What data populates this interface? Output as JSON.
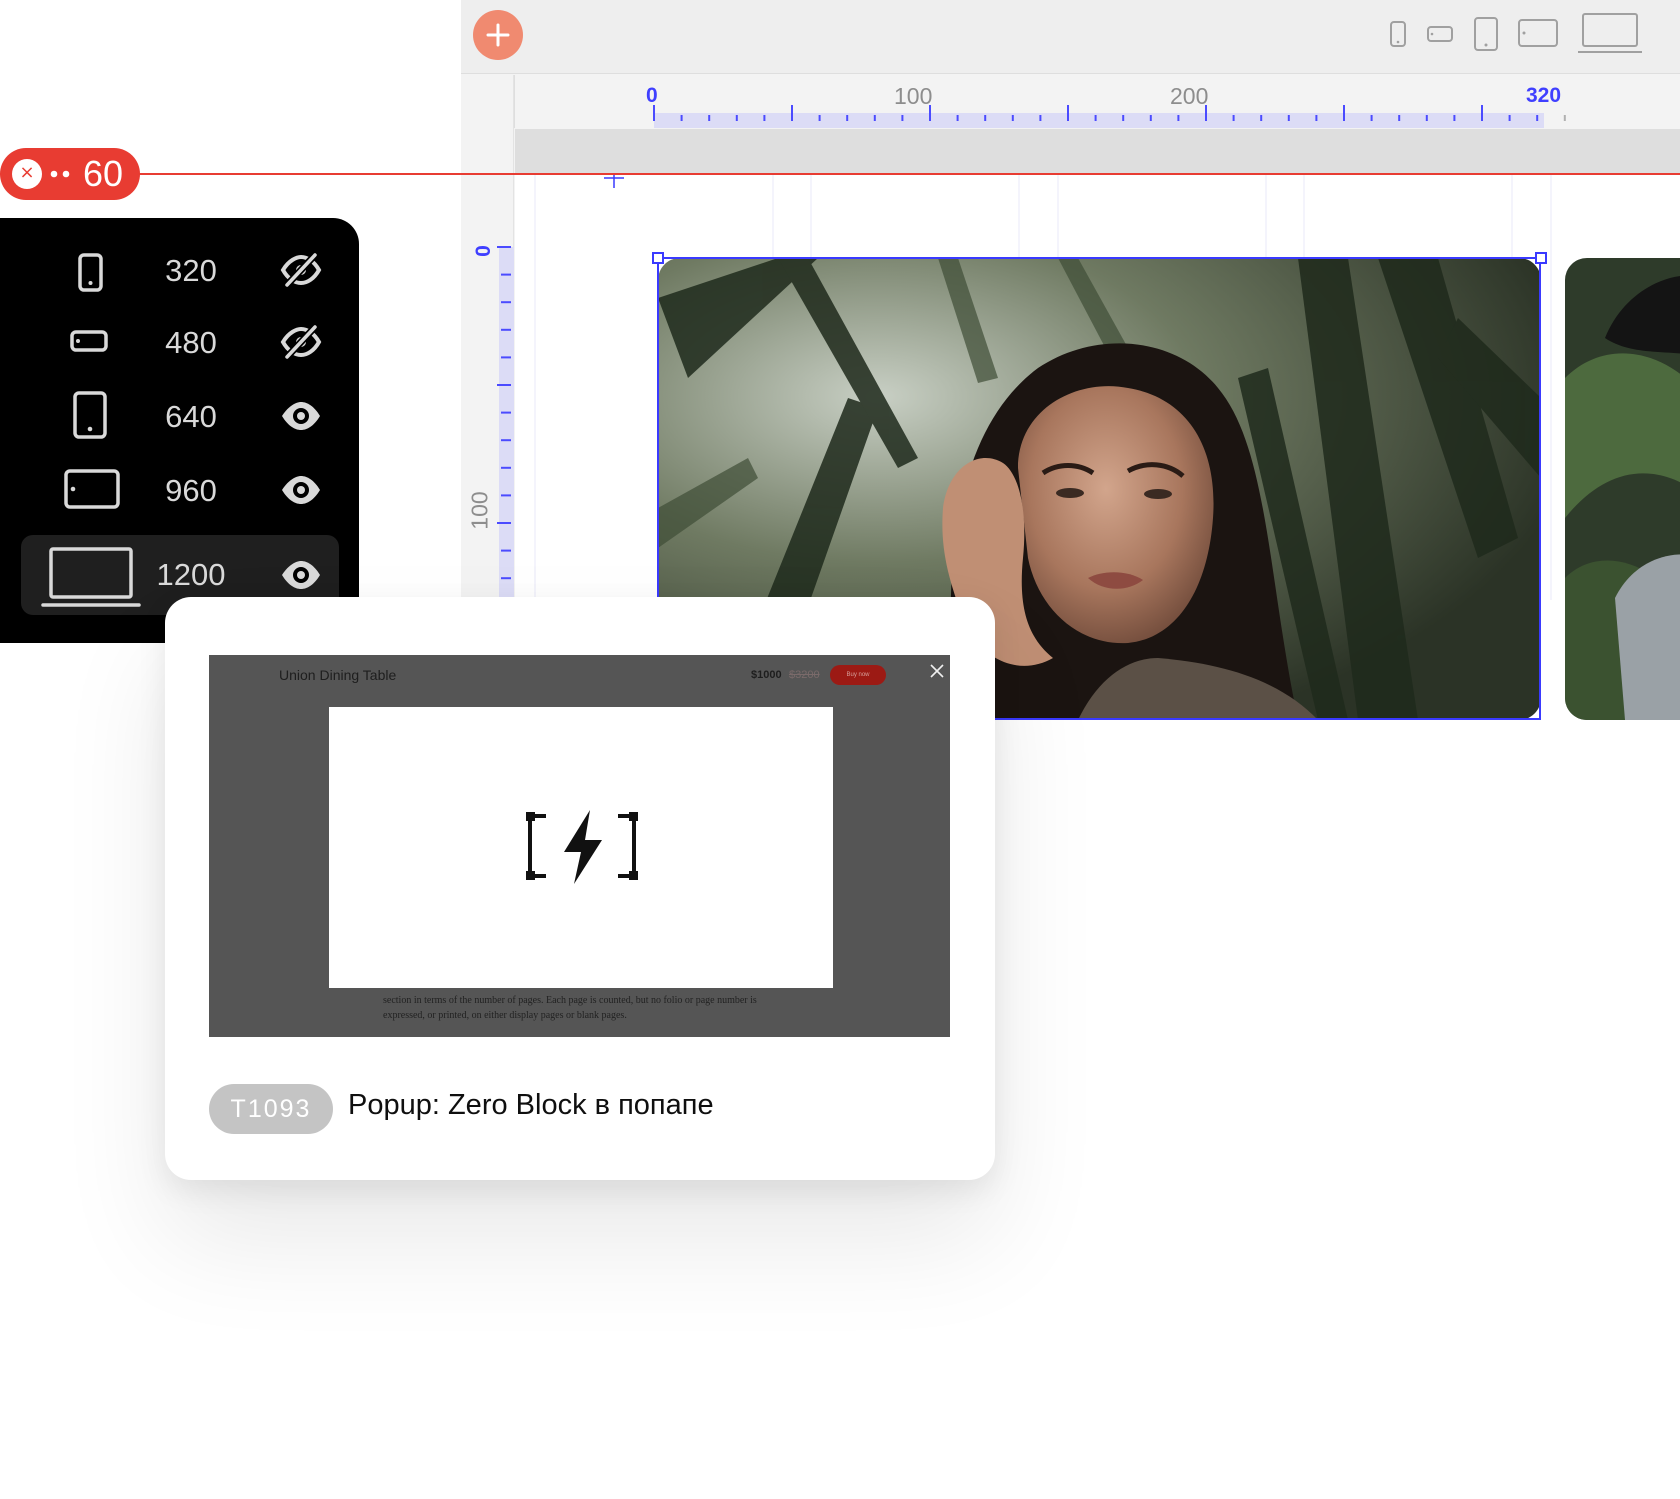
{
  "guide": {
    "value": "60",
    "close_glyph": "×",
    "color": "#e83c32"
  },
  "toolbar": {
    "add_glyph": "+",
    "accent": "#f08a70",
    "devices": [
      "phone-portrait-icon",
      "phone-landscape-icon",
      "tablet-portrait-icon",
      "tablet-landscape-icon",
      "laptop-icon"
    ]
  },
  "ruler": {
    "top_labels": [
      "0",
      "100",
      "200",
      "320"
    ],
    "left_labels": [
      "0",
      "100"
    ],
    "highlight_color": "#3f3fff"
  },
  "breakpoints": [
    {
      "width": "320",
      "device": "phone-portrait-icon",
      "visibility": "eye-off-icon"
    },
    {
      "width": "480",
      "device": "phone-landscape-icon",
      "visibility": "eye-off-icon"
    },
    {
      "width": "640",
      "device": "tablet-portrait-icon",
      "visibility": "eye-icon"
    },
    {
      "width": "960",
      "device": "tablet-landscape-icon",
      "visibility": "eye-icon"
    },
    {
      "width": "1200",
      "device": "laptop-icon",
      "visibility": "eye-icon",
      "active": true
    }
  ],
  "template_card": {
    "tag": "T1093",
    "title": "Popup: Zero Block в попапе",
    "preview": {
      "product_title": "Union Dining Table",
      "price": "$1000",
      "old_price": "$3200",
      "buy_label": "Buy now",
      "body_text": "section in terms of the number of pages. Each page is counted, but no folio or page number is expressed, or printed, on either display pages or blank pages."
    }
  }
}
